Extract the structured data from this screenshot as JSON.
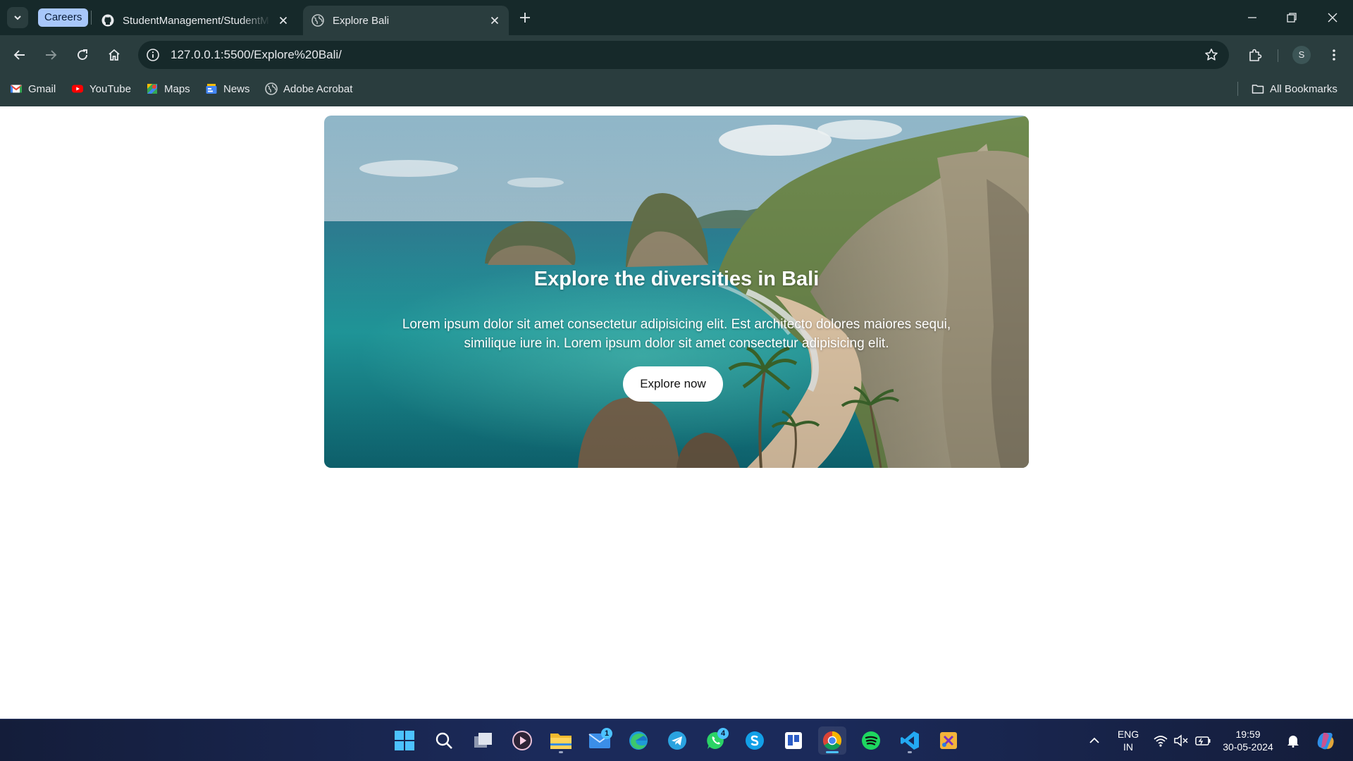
{
  "browser": {
    "tab_group_label": "Careers",
    "tabs": [
      {
        "title": "StudentManagement/StudentM"
      },
      {
        "title": "Explore Bali"
      }
    ],
    "url": "127.0.0.1:5500/Explore%20Bali/",
    "profile_initial": "S",
    "bookmarks": [
      {
        "label": "Gmail",
        "icon": "gmail-icon"
      },
      {
        "label": "YouTube",
        "icon": "youtube-icon"
      },
      {
        "label": "Maps",
        "icon": "maps-icon"
      },
      {
        "label": "News",
        "icon": "news-icon"
      },
      {
        "label": "Adobe Acrobat",
        "icon": "globe-icon"
      }
    ],
    "all_bookmarks_label": "All Bookmarks"
  },
  "hero": {
    "title": "Explore the diversities in Bali",
    "text": "Lorem ipsum dolor sit amet consectetur adipisicing elit. Est architecto dolores maiores sequi, similique iure in. Lorem ipsum dolor sit amet consectetur adipisicing elit.",
    "button_label": "Explore now"
  },
  "taskbar": {
    "mail_badge": "1",
    "whatsapp_badge": "4",
    "language": "ENG",
    "region": "IN",
    "time": "19:59",
    "date": "30-05-2024"
  },
  "colors": {
    "tabbar_bg": "#16292a",
    "toolbar_bg": "#2a3d3e",
    "tab_group_chip": "#a8c7fa",
    "taskbar_bg": "#1b2a5a"
  }
}
